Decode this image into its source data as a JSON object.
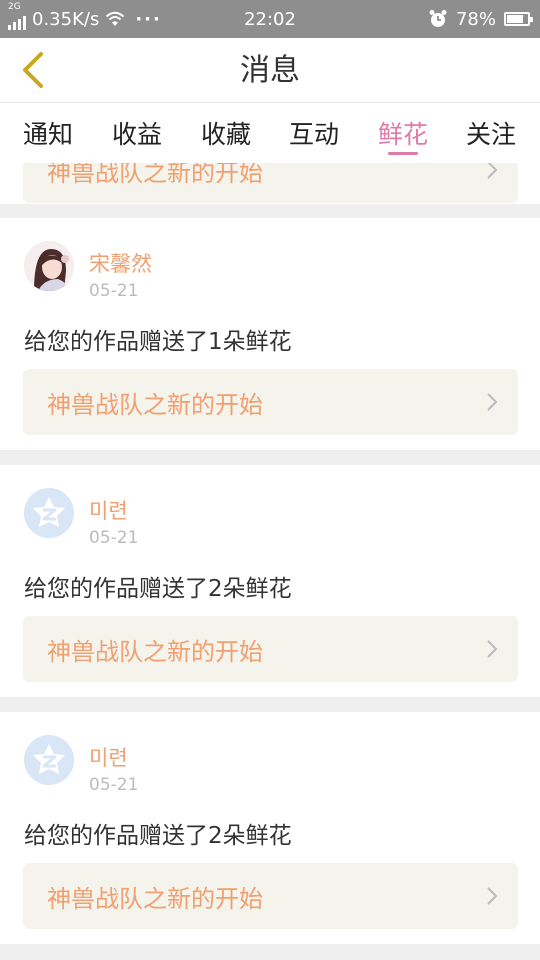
{
  "status_bar": {
    "network_type": "2G",
    "speed": "0.35K/s",
    "time": "22:02",
    "battery": "78%",
    "battery_level": 0.78
  },
  "header": {
    "title": "消息"
  },
  "tabs": [
    {
      "label": "通知",
      "active": false
    },
    {
      "label": "收益",
      "active": false
    },
    {
      "label": "收藏",
      "active": false
    },
    {
      "label": "互动",
      "active": false
    },
    {
      "label": "鲜花",
      "active": true
    },
    {
      "label": "关注",
      "active": false
    }
  ],
  "partial_card": {
    "work_title": "神兽战队之新的开始"
  },
  "messages": [
    {
      "username": "宋馨然",
      "date": "05-21",
      "text": "给您的作品赠送了1朵鲜花",
      "work_title": "神兽战队之新的开始",
      "avatar": "photo-avatar"
    },
    {
      "username": "미련",
      "date": "05-21",
      "text": "给您的作品赠送了2朵鲜花",
      "work_title": "神兽战队之新的开始",
      "avatar": "default-z-avatar"
    },
    {
      "username": "미련",
      "date": "05-21",
      "text": "给您的作品赠送了2朵鲜花",
      "work_title": "神兽战队之新的开始",
      "avatar": "default-z-avatar"
    }
  ],
  "colors": {
    "accent": "#e07aa8",
    "link_text": "#f0a070",
    "link_bg": "#f4f3ec",
    "status_bar": "#8e8e8e",
    "background": "#efefef"
  }
}
